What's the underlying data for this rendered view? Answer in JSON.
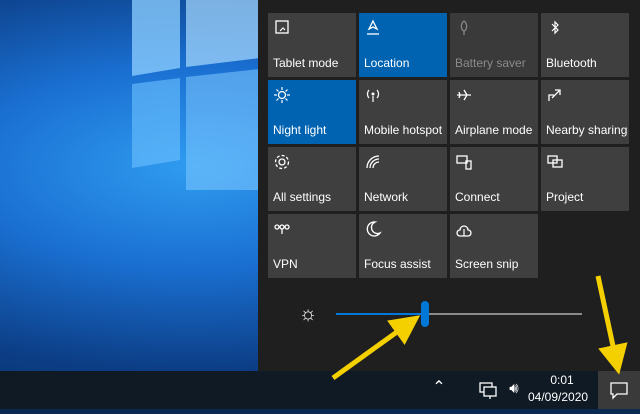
{
  "quick_actions": [
    {
      "label": "Tablet mode",
      "icon": "tablet-mode-icon",
      "state": "off"
    },
    {
      "label": "Location",
      "icon": "location-icon",
      "state": "on"
    },
    {
      "label": "Battery saver",
      "icon": "battery-saver-icon",
      "state": "disabled"
    },
    {
      "label": "Bluetooth",
      "icon": "bluetooth-icon",
      "state": "off"
    },
    {
      "label": "Night light",
      "icon": "night-light-icon",
      "state": "on"
    },
    {
      "label": "Mobile hotspot",
      "icon": "mobile-hotspot-icon",
      "state": "off"
    },
    {
      "label": "Airplane mode",
      "icon": "airplane-mode-icon",
      "state": "off"
    },
    {
      "label": "Nearby sharing",
      "icon": "nearby-sharing-icon",
      "state": "off"
    },
    {
      "label": "All settings",
      "icon": "settings-icon",
      "state": "off"
    },
    {
      "label": "Network",
      "icon": "network-icon",
      "state": "off"
    },
    {
      "label": "Connect",
      "icon": "connect-icon",
      "state": "off"
    },
    {
      "label": "Project",
      "icon": "project-icon",
      "state": "off"
    },
    {
      "label": "VPN",
      "icon": "vpn-icon",
      "state": "off"
    },
    {
      "label": "Focus assist",
      "icon": "focus-assist-icon",
      "state": "off"
    },
    {
      "label": "Screen snip",
      "icon": "screen-snip-icon",
      "state": "off"
    }
  ],
  "brightness": {
    "level_fraction": 0.36
  },
  "taskbar": {
    "time": "0:01",
    "date": "04/09/2020"
  },
  "colors": {
    "accent": "#0078d7",
    "tile_active": "#0063b1",
    "tile": "#3f3f3f",
    "annotation_arrow": "#f5d000"
  }
}
